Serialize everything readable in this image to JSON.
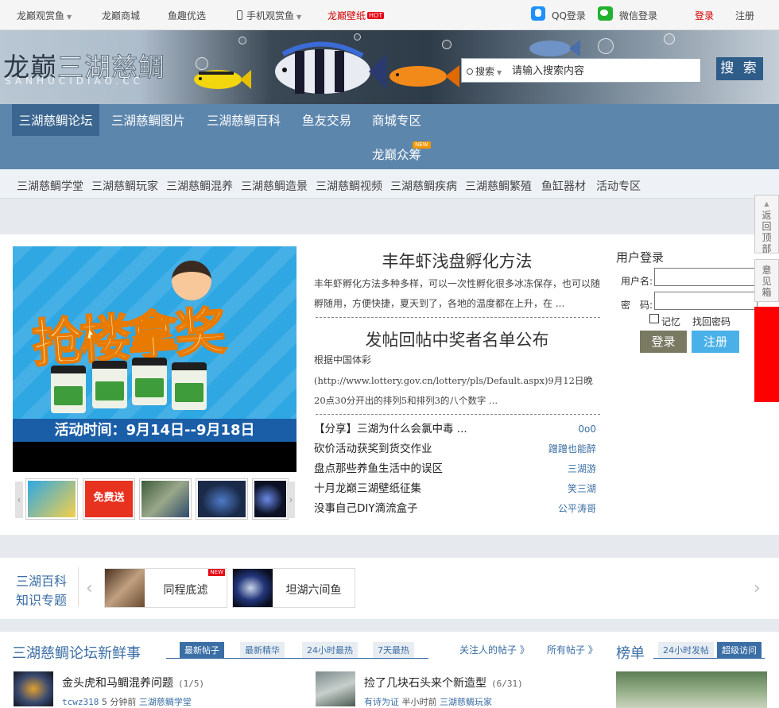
{
  "topbar": {
    "guanshang": "龙巅观赏鱼",
    "shop": "龙巅商城",
    "yuqu": "鱼趣优选",
    "mobile": "手机观赏鱼",
    "wallpaper": "龙巅壁纸",
    "hot": "HOT",
    "qq_login": "QQ登录",
    "wechat_login": "微信登录",
    "login": "登录",
    "register": "注册"
  },
  "header": {
    "logo_dark": "龙巅",
    "logo_light": "三湖慈鲷",
    "logo_en": "SANHUCIDIAO.CC",
    "search_type": "搜索",
    "search_placeholder": "请输入搜索内容",
    "search_button": "搜 索"
  },
  "nav": {
    "items": [
      "三湖慈鲷论坛",
      "三湖慈鲷图片",
      "三湖慈鲷百科",
      "鱼友交易",
      "商城专区"
    ],
    "crowdfund": "龙巅众筹",
    "new_badge": "NEW"
  },
  "subnav": [
    "三湖慈鲷学堂",
    "三湖慈鲷玩家",
    "三湖慈鲷混养",
    "三湖慈鲷造景",
    "三湖慈鲷视频",
    "三湖慈鲷疾病",
    "三湖慈鲷繁殖",
    "鱼缸器材",
    "活动专区"
  ],
  "slider": {
    "promo_title": "抢楼拿奖",
    "caption": "活动时间：9月14日--9月18日",
    "thumb_promo": "免费送"
  },
  "news": {
    "headline1": "丰年虾浅盘孵化方法",
    "summary1": "丰年虾孵化方法多种多样，可以一次性孵化很多冰冻保存，也可以随孵随用，方便快捷，夏天到了，各地的温度都在上升，在 ...",
    "headline2": "发帖回帖中奖者名单公布",
    "summary2_line1": "根据中国体彩",
    "summary2_line2": "(http://www.lottery.gov.cn/lottery/pls/Default.aspx)9月12日晚20点30分开出的排列5和排列3的八个数字 ...",
    "posts": [
      {
        "title": "【分享】三湖为什么会氯中毒 ...",
        "author": "0o0"
      },
      {
        "title": "砍价活动获奖到货交作业",
        "author": "蹭蹭也能醉"
      },
      {
        "title": "盘点那些养鱼生活中的误区",
        "author": "三湖游"
      },
      {
        "title": "十月龙巅三湖壁纸征集",
        "author": "笑三湖"
      },
      {
        "title": "没事自己DIY滴流盒子",
        "author": "公平涛哥"
      }
    ]
  },
  "login": {
    "title": "用户登录",
    "username_label": "用户名:",
    "password_label": "密　码:",
    "remember": "记忆",
    "forgot": "找回密码",
    "login_btn": "登录",
    "register_btn": "注册"
  },
  "side": {
    "back_top": "返回顶部",
    "feedback": "意见箱"
  },
  "knowledge": {
    "title1": "三湖百科",
    "title2": "知识专题",
    "card1": "同程底滤",
    "card2": "坦湖六间鱼",
    "card_badge": "NEW"
  },
  "bottom": {
    "section_title": "三湖慈鲷论坛新鲜事",
    "tabs": [
      "最新帖子",
      "最新精华",
      "24小时最热",
      "7天最热"
    ],
    "follow": "关注人的帖子 》",
    "all_posts": "所有帖子 》",
    "rank_title": "榜单",
    "rank_tabs": [
      "24小时发帖",
      "超级访问"
    ],
    "thread1_title": "金头虎和马鲷混养问题",
    "thread1_count": "(1/5)",
    "thread1_user": "tcwz318",
    "thread1_time": "5 分钟前",
    "thread1_forum": "三湖慈鲷学堂",
    "thread2_title": "捡了几块石头来个新造型",
    "thread2_count": "(6/31)",
    "thread2_user": "有诗为证",
    "thread2_time": "半小时前",
    "thread2_forum": "三湖慈鲷玩家"
  }
}
